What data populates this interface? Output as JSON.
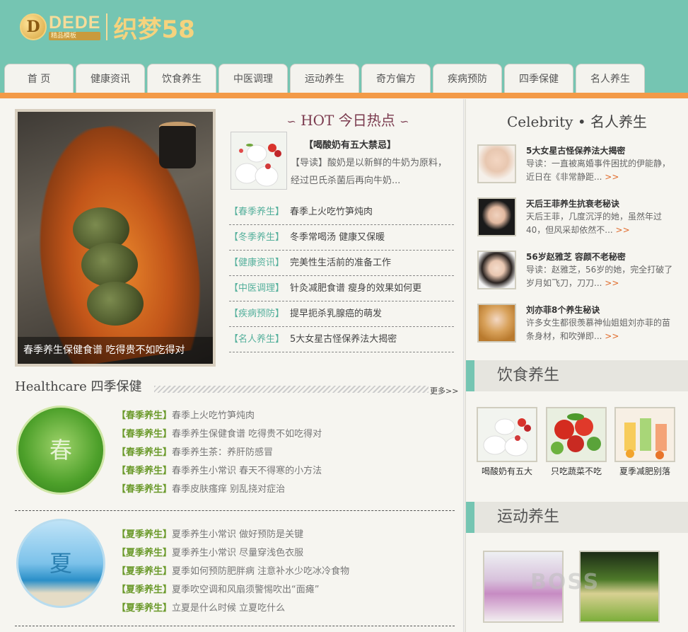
{
  "logo": {
    "badge": "D",
    "dede": "DEDE",
    "sub": "精品模板",
    "name": "织梦58"
  },
  "nav": [
    "首 页",
    "健康资讯",
    "饮食养生",
    "中医调理",
    "运动养生",
    "奇方偏方",
    "疾病预防",
    "四季保健",
    "名人养生"
  ],
  "feature": {
    "caption": "春季养生保健食谱 吃得贵不如吃得对"
  },
  "hot": {
    "title": "HOT 今日热点",
    "headline": "【喝酸奶有五大禁忌】",
    "desc": "【导读】酸奶是以新鲜的牛奶为原料，经过巴氏杀菌后再向牛奶...",
    "items": [
      {
        "cat": "【春季养生】",
        "title": "春季上火吃竹笋炖肉"
      },
      {
        "cat": "【冬季养生】",
        "title": "冬季常喝汤 健康又保暖"
      },
      {
        "cat": "【健康资讯】",
        "title": "完美性生活前的准备工作"
      },
      {
        "cat": "【中医调理】",
        "title": "针灸减肥食谱 瘦身的效果如何更"
      },
      {
        "cat": "【疾病预防】",
        "title": "提早扼杀乳腺癌的萌发"
      },
      {
        "cat": "【名人养生】",
        "title": "5大女星古怪保养法大揭密"
      }
    ]
  },
  "healthcare": {
    "title": "Healthcare 四季保健",
    "more": "更多>>",
    "spring": {
      "label": "春",
      "items": [
        {
          "cat": "【春季养生】",
          "title": "春季上火吃竹笋炖肉"
        },
        {
          "cat": "【春季养生】",
          "title": "春季养生保健食谱 吃得贵不如吃得对"
        },
        {
          "cat": "【春季养生】",
          "title": "春季养生茶：养肝防感冒"
        },
        {
          "cat": "【春季养生】",
          "title": "春季养生小常识 春天不得寒的小方法"
        },
        {
          "cat": "【春季养生】",
          "title": "春季皮肤瘙痒 别乱挠对症治"
        }
      ]
    },
    "summer": {
      "label": "夏",
      "items": [
        {
          "cat": "【夏季养生】",
          "title": "夏季养生小常识 做好预防是关键"
        },
        {
          "cat": "【夏季养生】",
          "title": "夏季养生小常识 尽量穿浅色衣服"
        },
        {
          "cat": "【夏季养生】",
          "title": "夏季如何预防肥胖病 注意补水少吃冰冷食物"
        },
        {
          "cat": "【夏季养生】",
          "title": "夏季吹空调和风扇须警惕吹出“面瘫”"
        },
        {
          "cat": "【夏季养生】",
          "title": "立夏是什么时候 立夏吃什么"
        }
      ]
    }
  },
  "celebrity": {
    "title": "Celebrity • 名人养生",
    "items": [
      {
        "name": "5大女星古怪保养法大揭密",
        "desc": "导读：一直被离婚事件困扰的伊能静，近日在《非常静距...",
        "more": ">>"
      },
      {
        "name": "天后王菲养生抗衰老秘诀",
        "desc": "天后王菲，几度沉浮的她，虽然年过40，但风采却依然不...",
        "more": ">>"
      },
      {
        "name": "56岁赵雅芝 容颜不老秘密",
        "desc": "导读：赵雅芝，56岁的她，完全打破了岁月如飞刀，刀刀...",
        "more": ">>"
      },
      {
        "name": "刘亦菲8个养生秘诀",
        "desc": "许多女生都很羡慕神仙姐姐刘亦菲的苗条身材，和吹弹即...",
        "more": ">>"
      }
    ]
  },
  "diet": {
    "title": "饮食养生",
    "items": [
      "喝酸奶有五大",
      "只吃蔬菜不吃",
      "夏季减肥别落"
    ]
  },
  "sport": {
    "title": "运动养生"
  },
  "watermark": "BOSS"
}
